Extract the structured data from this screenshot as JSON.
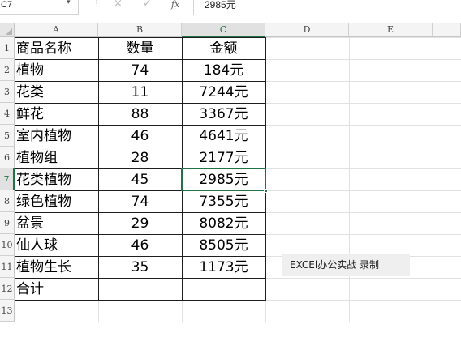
{
  "formula_bar": {
    "name_box": "C7",
    "value": "2985元",
    "cancel_icon": "×",
    "confirm_icon": "✓",
    "fx_label": "fx",
    "name_arrow": "▾",
    "separator": "⋮"
  },
  "columns": [
    "A",
    "B",
    "C",
    "D",
    "E"
  ],
  "rows": [
    "1",
    "2",
    "3",
    "4",
    "5",
    "6",
    "7",
    "8",
    "9",
    "10",
    "11",
    "12",
    "13"
  ],
  "table": {
    "headers": [
      "商品名称",
      "数量",
      "金额"
    ],
    "rows": [
      [
        "植物",
        "74",
        "184元"
      ],
      [
        "花类",
        "11",
        "7244元"
      ],
      [
        "鲜花",
        "88",
        "3367元"
      ],
      [
        "室内植物",
        "46",
        "4641元"
      ],
      [
        "植物组",
        "28",
        "2177元"
      ],
      [
        "花类植物",
        "45",
        "2985元"
      ],
      [
        "绿色植物",
        "74",
        "7355元"
      ],
      [
        "盆景",
        "29",
        "8082元"
      ],
      [
        "仙人球",
        "46",
        "8505元"
      ],
      [
        "植物生长",
        "35",
        "1173元"
      ]
    ],
    "total_label": "合计"
  },
  "active_cell": {
    "column": "C",
    "row": "7"
  },
  "accent_color": "#217346",
  "watermark": "EXCEl办公实战 录制"
}
